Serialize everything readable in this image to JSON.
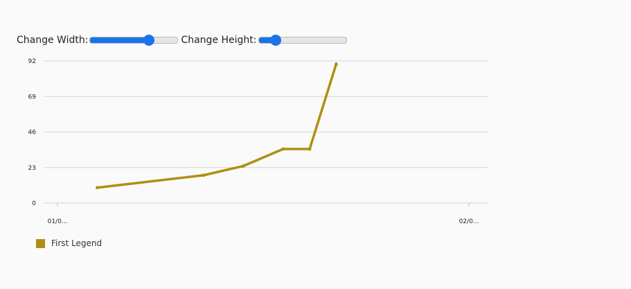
{
  "controls": {
    "width_label": "Change Width:",
    "width_value": 70,
    "height_label": "Change Height:",
    "height_value": 15
  },
  "colors": {
    "series": "#b08f0f",
    "slider_accent": "#1a73e8",
    "grid": "#d3d3d3"
  },
  "chart_data": {
    "type": "line",
    "title": "",
    "xlabel": "",
    "ylabel": "",
    "x_ticks": [
      "01/0...",
      "02/0..."
    ],
    "y_ticks": [
      0,
      23,
      46,
      69,
      92
    ],
    "ylim": [
      0,
      92
    ],
    "x_axis": "date",
    "x_range": [
      "01/01",
      "02/01"
    ],
    "grid": true,
    "legend_position": "bottom-left",
    "series": [
      {
        "name": "First Legend",
        "color": "#b08f0f",
        "x": [
          "01/04",
          "01/12",
          "01/15",
          "01/18",
          "01/20",
          "01/22"
        ],
        "y": [
          10,
          18,
          24,
          35,
          35,
          90
        ]
      }
    ]
  }
}
